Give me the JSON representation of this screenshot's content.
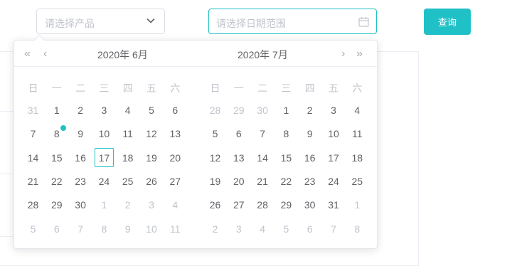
{
  "filters": {
    "product_placeholder": "请选择产品",
    "daterange_placeholder": "请选择日期范围",
    "query_label": "查询"
  },
  "colors": {
    "accent": "#1fc1c6",
    "muted": "#c0c4cc",
    "text": "#606266"
  },
  "calendar": {
    "nav": {
      "prev_year": "«",
      "prev_month": "‹",
      "next_month": "›",
      "next_year": "»"
    },
    "weekdays": [
      "日",
      "一",
      "二",
      "三",
      "四",
      "五",
      "六"
    ],
    "left": {
      "title": "2020年 6月",
      "weeks": [
        [
          "31",
          "1",
          "2",
          "3",
          "4",
          "5",
          "6"
        ],
        [
          "7",
          "8",
          "9",
          "10",
          "11",
          "12",
          "13"
        ],
        [
          "14",
          "15",
          "16",
          "17",
          "18",
          "19",
          "20"
        ],
        [
          "21",
          "22",
          "23",
          "24",
          "25",
          "26",
          "27"
        ],
        [
          "28",
          "29",
          "30",
          "1",
          "2",
          "3",
          "4"
        ],
        [
          "5",
          "6",
          "7",
          "8",
          "9",
          "10",
          "11"
        ]
      ],
      "current": [
        [
          false,
          true,
          true,
          true,
          true,
          true,
          true
        ],
        [
          true,
          true,
          true,
          true,
          true,
          true,
          true
        ],
        [
          true,
          true,
          true,
          true,
          true,
          true,
          true
        ],
        [
          true,
          true,
          true,
          true,
          true,
          true,
          true
        ],
        [
          true,
          true,
          true,
          false,
          false,
          false,
          false
        ],
        [
          false,
          false,
          false,
          false,
          false,
          false,
          false
        ]
      ]
    },
    "right": {
      "title": "2020年 7月",
      "weeks": [
        [
          "28",
          "29",
          "30",
          "1",
          "2",
          "3",
          "4"
        ],
        [
          "5",
          "6",
          "7",
          "8",
          "9",
          "10",
          "11"
        ],
        [
          "12",
          "13",
          "14",
          "15",
          "16",
          "17",
          "18"
        ],
        [
          "19",
          "20",
          "21",
          "22",
          "23",
          "24",
          "25"
        ],
        [
          "26",
          "27",
          "28",
          "29",
          "30",
          "31",
          "1"
        ],
        [
          "2",
          "3",
          "4",
          "5",
          "6",
          "7",
          "8"
        ]
      ],
      "current": [
        [
          false,
          false,
          false,
          true,
          true,
          true,
          true
        ],
        [
          true,
          true,
          true,
          true,
          true,
          true,
          true
        ],
        [
          true,
          true,
          true,
          true,
          true,
          true,
          true
        ],
        [
          true,
          true,
          true,
          true,
          true,
          true,
          true
        ],
        [
          true,
          true,
          true,
          true,
          true,
          true,
          false
        ],
        [
          false,
          false,
          false,
          false,
          false,
          false,
          false
        ]
      ]
    },
    "today": "17",
    "event_day": "8"
  }
}
